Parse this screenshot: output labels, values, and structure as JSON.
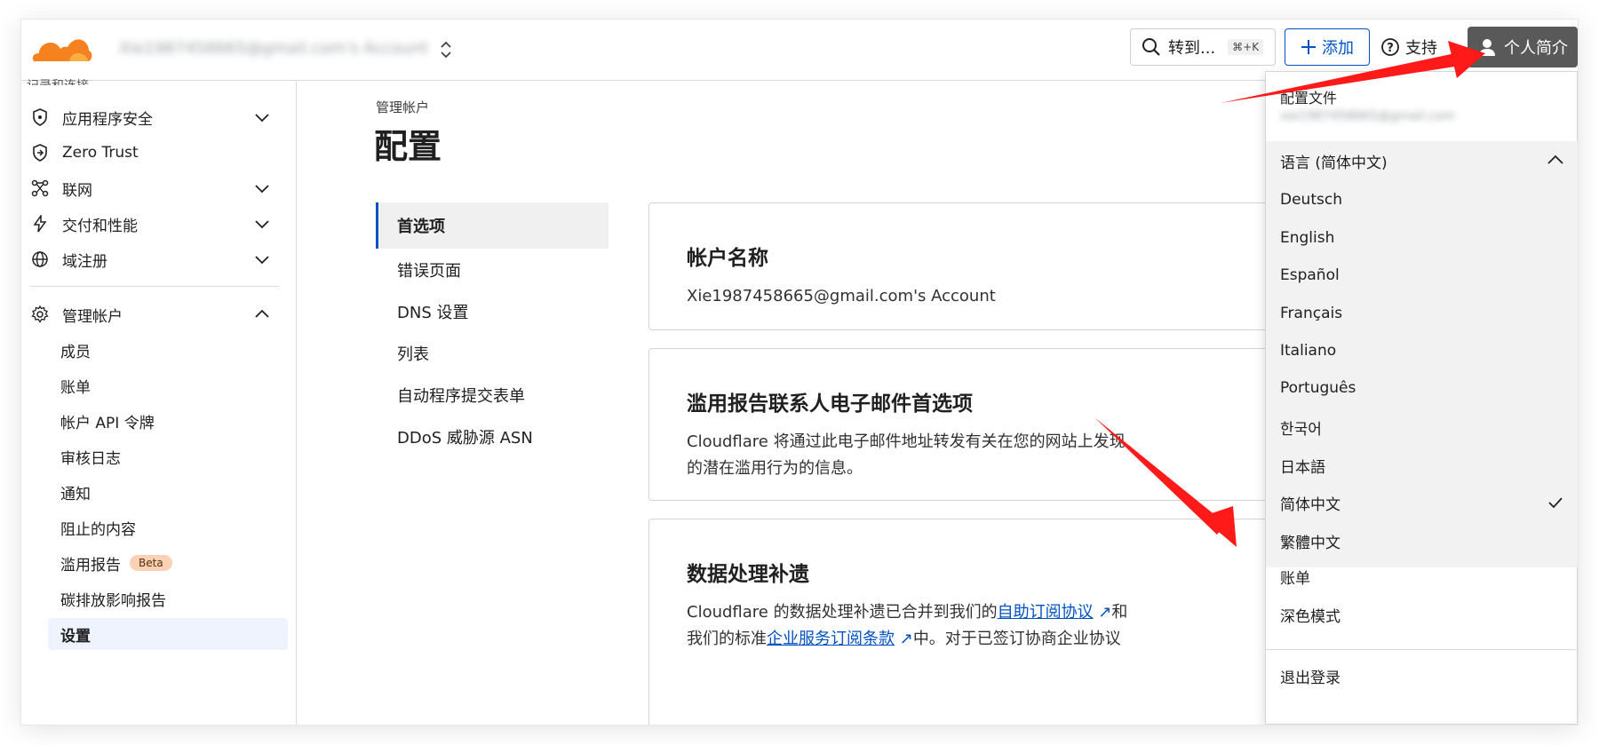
{
  "topbar": {
    "account_email": "Xie1987458665@gmail.com's Account",
    "search_label": "转到...",
    "search_shortcut": "⌘+K",
    "add_label": "添加",
    "support_label": "支持",
    "profile_label": "个人简介"
  },
  "sidebar": {
    "clipped_item": "记录和连接",
    "items": [
      {
        "label": "应用程序安全",
        "icon": "shield-icon"
      },
      {
        "label": "Zero Trust",
        "icon": "zero-trust-icon"
      },
      {
        "label": "联网",
        "icon": "network-icon"
      },
      {
        "label": "交付和性能",
        "icon": "lightning-icon"
      },
      {
        "label": "域注册",
        "icon": "globe-icon"
      }
    ],
    "manage_label": "管理帐户",
    "sub_items": [
      "成员",
      "账单",
      "帐户 API 令牌",
      "审核日志",
      "通知",
      "阻止的内容",
      "滥用报告",
      "碳排放影响报告",
      "设置"
    ],
    "beta_label": "Beta"
  },
  "main": {
    "breadcrumb": "管理帐户",
    "title": "配置",
    "subnav": [
      "首选项",
      "错误页面",
      "DNS 设置",
      "列表",
      "自动程序提交表单",
      "DDoS 威胁源 ASN"
    ],
    "cards": [
      {
        "title": "帐户名称",
        "body": "Xie1987458665@gmail.com's Account"
      },
      {
        "title": "滥用报告联系人电子邮件首选项",
        "body_line1": "Cloudflare 将通过此电子邮件地址转发有关在您的网站上发现",
        "body_line2": "的潜在滥用行为的信息。"
      },
      {
        "title": "数据处理补遗",
        "line1_pre": "Cloudflare 的数据处理补遗已合并到我们的",
        "line1_link": "自助订阅协议",
        "line1_post": "和",
        "line2_pre": "我们的标准",
        "line2_link": "企业服务订阅条款",
        "line2_post": "中。对于已签订协商企业协议"
      }
    ]
  },
  "dropdown": {
    "profile_title": "配置文件",
    "profile_email": "xie1987458665@gmail.com",
    "language_title": "语言 (简体中文)",
    "languages": [
      "Deutsch",
      "English",
      "Español",
      "Français",
      "Italiano",
      "Português",
      "한국어",
      "日本語",
      "简体中文",
      "繁體中文"
    ],
    "selected_language": "简体中文",
    "billing": "账单",
    "dark_mode": "深色模式",
    "logout": "退出登录"
  },
  "colors": {
    "accent": "#0051c3",
    "logo_orange": "#f6821f",
    "arrow_red": "#ff1a1a",
    "profile_bg": "#595959"
  }
}
